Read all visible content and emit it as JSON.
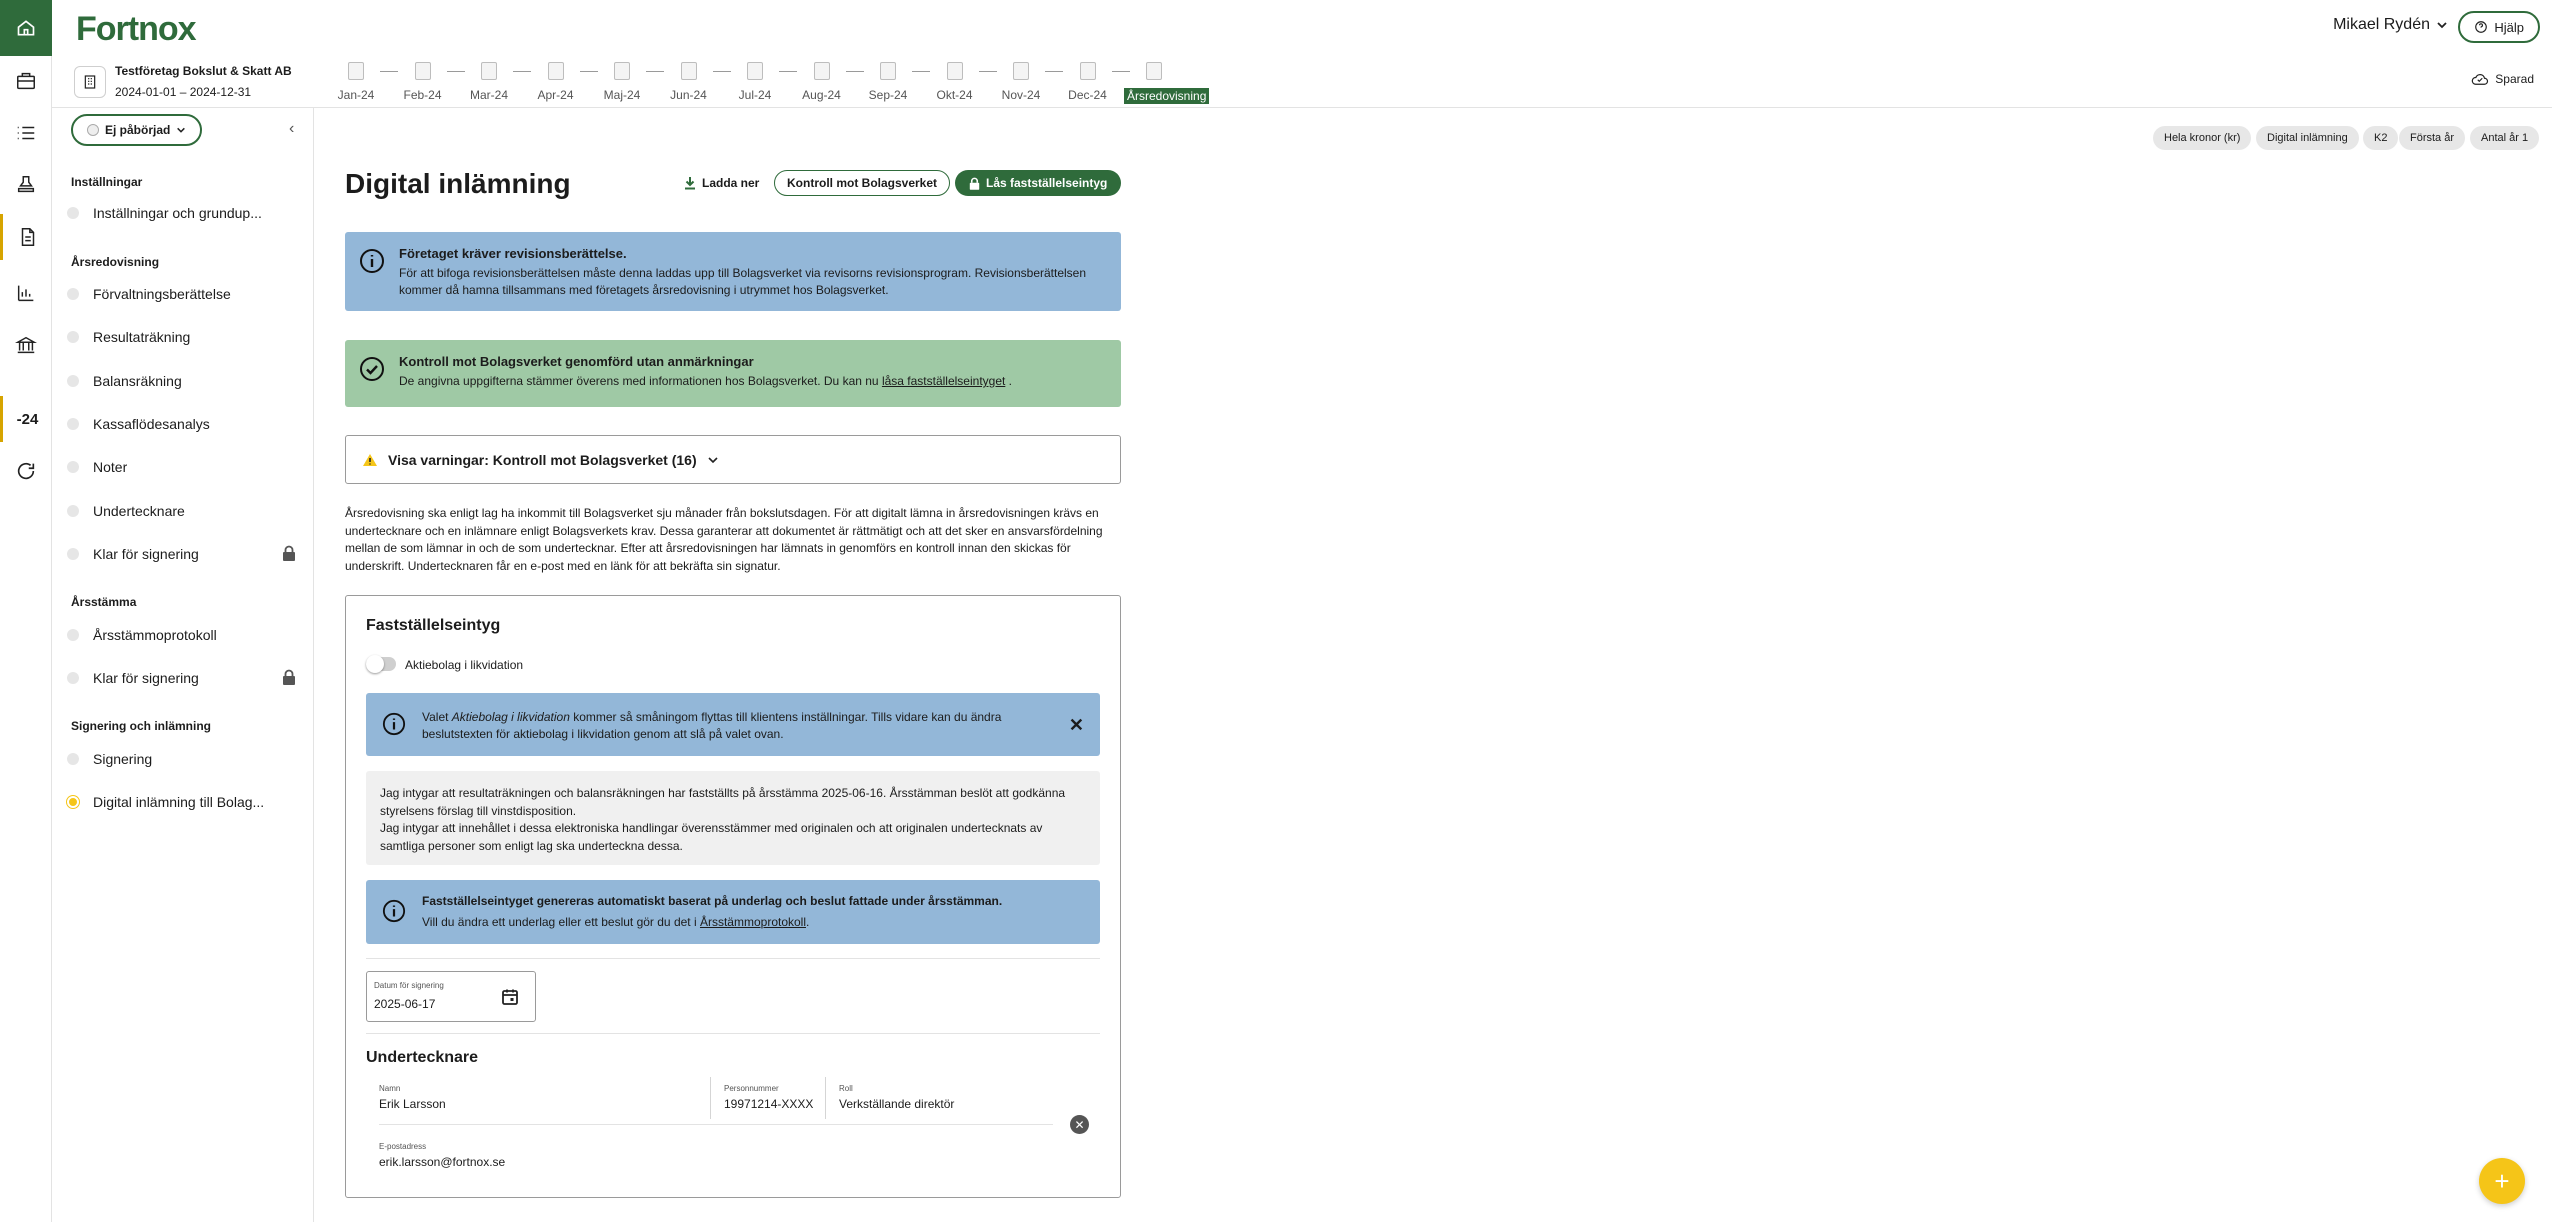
{
  "brand": {
    "logo": "Fortnox",
    "accent": "#2f6b3b",
    "highlight": "#f5c518"
  },
  "rail": {
    "period_label": "-24",
    "icons": [
      "home-icon",
      "briefcase-icon",
      "list-icon",
      "stamp-icon",
      "document-icon",
      "chart-icon",
      "bank-icon",
      "refresh-icon"
    ]
  },
  "header": {
    "user": "Mikael Rydén",
    "help": "Hjälp",
    "saved": "Sparad"
  },
  "company": {
    "name": "Testföretag Bokslut & Skatt AB",
    "period": "2024-01-01 – 2024-12-31"
  },
  "timeline": [
    "Jan-24",
    "Feb-24",
    "Mar-24",
    "Apr-24",
    "Maj-24",
    "Jun-24",
    "Jul-24",
    "Aug-24",
    "Sep-24",
    "Okt-24",
    "Nov-24",
    "Dec-24",
    "Årsredovisning"
  ],
  "sidebar": {
    "status": "Ej påbörjad",
    "sections": [
      {
        "title": "Inställningar",
        "items": [
          {
            "label": "Inställningar och grundup..."
          }
        ]
      },
      {
        "title": "Årsredovisning",
        "items": [
          {
            "label": "Förvaltningsberättelse"
          },
          {
            "label": "Resultaträkning"
          },
          {
            "label": "Balansräkning"
          },
          {
            "label": "Kassaflödesanalys"
          },
          {
            "label": "Noter"
          },
          {
            "label": "Undertecknare"
          },
          {
            "label": "Klar för signering"
          }
        ]
      },
      {
        "title": "Årsstämma",
        "items": [
          {
            "label": "Årsstämmoprotokoll"
          },
          {
            "label": "Klar för signering"
          }
        ]
      },
      {
        "title": "Signering och inlämning",
        "items": [
          {
            "label": "Signering"
          },
          {
            "label": "Digital inlämning till Bolag..."
          }
        ]
      }
    ]
  },
  "chips": [
    "Hela kronor (kr)",
    "Digital inlämning",
    "K2",
    "Första år",
    "Antal år 1"
  ],
  "main": {
    "title": "Digital inlämning",
    "download": "Ladda ner",
    "control": "Kontroll mot Bolagsverket",
    "lock": "Lås fastställelseintyg",
    "audit_banner": {
      "title": "Företaget kräver revisionsberättelse.",
      "body": "För att bifoga revisionsberättelsen måste denna laddas upp till Bolagsverket via revisorns revisionsprogram. Revisionsberättelsen kommer då hamna tillsammans med företagets årsredovisning i utrymmet hos Bolagsverket."
    },
    "success_banner": {
      "title": "Kontroll mot Bolagsverket genomförd utan anmärkningar",
      "body_pre": "De angivna uppgifterna stämmer överens med informationen hos Bolagsverket. Du kan nu ",
      "link": "låsa fastställelseintyget",
      "body_post": " ."
    },
    "warnings": "Visa varningar: Kontroll mot Bolagsverket (16)",
    "intro": "Årsredovisning ska enligt lag ha inkommit till Bolagsverket sju månader från bokslutsdagen. För att digitalt lämna in årsredovisningen krävs en undertecknare och en inlämnare enligt Bolagsverkets krav. Dessa garanterar att dokumentet är rättmätigt och att det sker en ansvarsfördelning mellan de som lämnar in och de som undertecknar. Efter att årsredovisningen har lämnats in genomförs en kontroll innan den skickas för underskrift. Undertecknaren får en e-post med en länk för att bekräfta sin signatur.",
    "card": {
      "title": "Fastställelseintyg",
      "toggle_label": "Aktiebolag i likvidation",
      "info_pre": "Valet ",
      "info_em": "Aktiebolag i likvidation",
      "info_post": " kommer så småningom flyttas till klientens inställningar. Tills vidare kan du ändra beslutstexten för aktiebolag i likvidation genom att slå på valet ovan.",
      "attest_1": "Jag intygar att resultaträkningen och balansräkningen har fastställts på årsstämma 2025-06-16. Årsstämman beslöt att godkänna styrelsens förslag till vinstdisposition.",
      "attest_2": "Jag intygar att innehållet i dessa elektroniska handlingar överensstämmer med originalen och att originalen undertecknats av samtliga personer som enligt lag ska underteckna dessa.",
      "auto_title": "Fastställelseintyget genereras automatiskt baserat på underlag och beslut fattade under årsstämman.",
      "auto_pre": "Vill du ändra ett underlag eller ett beslut gör du det i ",
      "auto_link": "Årsstämmoprotokoll",
      "auto_post": ".",
      "date_label": "Datum för signering",
      "date_value": "2025-06-17",
      "signers_title": "Undertecknare",
      "signer": {
        "name_label": "Namn",
        "name": "Erik Larsson",
        "pnr_label": "Personnummer",
        "pnr": "19971214-XXXX",
        "role_label": "Roll",
        "role": "Verkställande direktör",
        "email_label": "E-postadress",
        "email": "erik.larsson@fortnox.se"
      }
    }
  },
  "fab": "+"
}
